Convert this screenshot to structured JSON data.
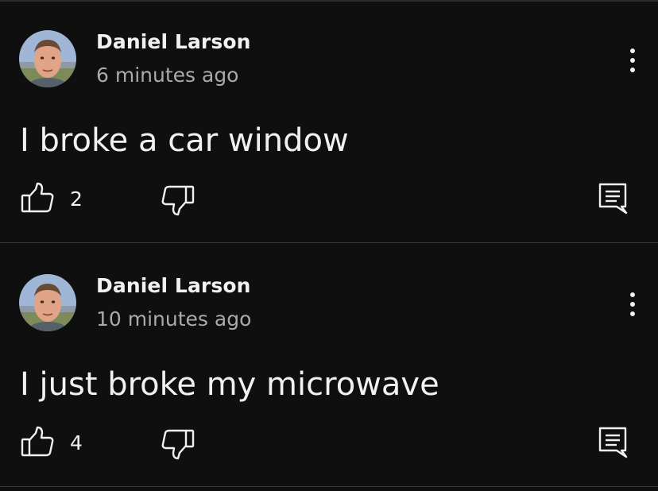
{
  "colors": {
    "background": "#0f0f0f",
    "primary_text": "#f1f1f1",
    "secondary_text": "#aaaaaa",
    "divider": "#3a3a3a"
  },
  "comments": [
    {
      "author": "Daniel Larson",
      "time": "6 minutes ago",
      "text": "I broke a car window",
      "likes": "2"
    },
    {
      "author": "Daniel Larson",
      "time": "10 minutes ago",
      "text": "I just broke my microwave",
      "likes": "4"
    }
  ],
  "icons": {
    "like": "thumbs-up-icon",
    "dislike": "thumbs-down-icon",
    "reply": "reply-comment-icon",
    "menu": "more-vertical-icon"
  }
}
